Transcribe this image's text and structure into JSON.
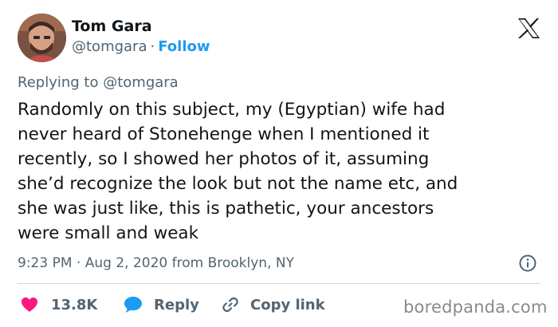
{
  "author": {
    "name": "Tom Gara",
    "handle": "@tomgara",
    "separator": "·",
    "follow_label": "Follow"
  },
  "reply_context": {
    "prefix": "Replying to",
    "handle": "@tomgara"
  },
  "tweet": {
    "lines": [
      "Randomly on this subject, my (Egyptian) wife had",
      "never heard of Stonehenge when I mentioned it",
      "recently, so I showed her photos of it, assuming",
      "she’d recognize the look but not the name etc, and",
      "she was just like, this is pathetic, your ancestors",
      "were small and weak"
    ],
    "timestamp": "9:23 PM · Aug 2, 2020 from Brooklyn, NY"
  },
  "actions": {
    "like_count": "13.8K",
    "reply_label": "Reply",
    "copy_link_label": "Copy link"
  },
  "watermark": "boredpanda.com",
  "icons": {
    "brand": "x-logo-icon",
    "info": "info-icon",
    "like": "heart-icon",
    "reply": "speech-bubble-icon",
    "copy": "link-icon"
  },
  "colors": {
    "text": "#0f1419",
    "secondary": "#536471",
    "accent": "#1d9bf0",
    "like": "#f91880",
    "divider": "#cfd9de"
  }
}
